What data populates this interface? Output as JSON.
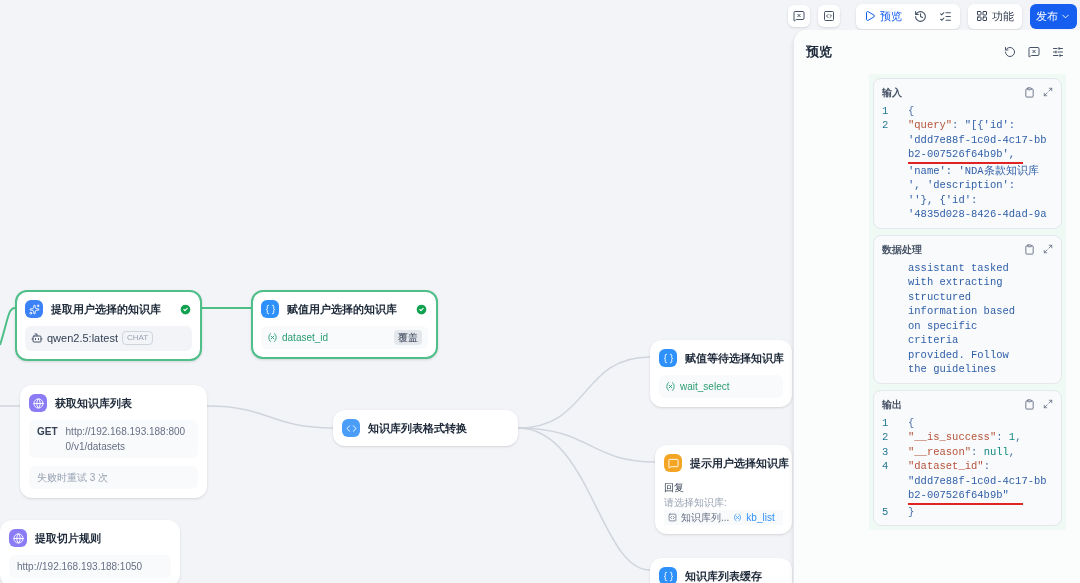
{
  "toolbar": {
    "buttons": [
      {
        "kind": "preview",
        "label": "预览"
      },
      {
        "kind": "features",
        "label": "功能"
      },
      {
        "kind": "publish",
        "label": "发布"
      }
    ]
  },
  "canvas": {
    "nodes": [
      {
        "kind": "llm",
        "title": "提取用户选择的知识库",
        "succeeded": true,
        "model": "qwen2.5:latest",
        "model_mode": "CHAT"
      },
      {
        "kind": "assigner",
        "title": "赋值用户选择的知识库",
        "succeeded": true,
        "variable": "dataset_id",
        "operation": "覆盖"
      },
      {
        "kind": "http",
        "title": "获取知识库列表",
        "succeeded": false,
        "method": "GET",
        "url": "http://192.168.193.188:8000/v1/datasets",
        "retry": "失败时重试 3 次"
      },
      {
        "kind": "code",
        "title": "知识库列表格式转换",
        "succeeded": false
      },
      {
        "kind": "assigner",
        "title": "赋值等待选择知识库",
        "succeeded": false,
        "variable": "wait_select"
      },
      {
        "kind": "answer",
        "title": "提示用户选择知识库",
        "succeeded": false,
        "reply_label": "回复",
        "reply_text": "请选择知识库:",
        "ref_node": "知识库列...",
        "ref_var": "kb_list"
      },
      {
        "kind": "http",
        "title": "提取切片规则",
        "succeeded": false,
        "url": "http://192.168.193.188:1050"
      },
      {
        "kind": "assigner",
        "title": "知识库列表缓存",
        "succeeded": false
      }
    ]
  },
  "preview_panel": {
    "title": "预览",
    "sections": [
      {
        "title": "输入",
        "rows": [
          {
            "number": "1",
            "tokens": [
              {
                "kind": "punct",
                "text": "{"
              }
            ]
          },
          {
            "number": "2",
            "tokens": [
              {
                "kind": "key",
                "text": "\"query\""
              },
              {
                "kind": "punct",
                "text": ": "
              },
              {
                "kind": "string",
                "text": "\"[{'id':"
              }
            ]
          },
          {
            "tokens": [
              {
                "kind": "string",
                "text": "'ddd7e88f-1c0d-4c17-bb"
              }
            ]
          },
          {
            "underlined": true,
            "tokens": [
              {
                "kind": "string",
                "text": "b2-007526f64b9b',"
              }
            ]
          },
          {
            "tokens": [
              {
                "kind": "string",
                "text": "'name': 'NDA条款知识库"
              }
            ]
          },
          {
            "tokens": [
              {
                "kind": "string",
                "text": "', 'description':"
              }
            ]
          },
          {
            "tokens": [
              {
                "kind": "string",
                "text": "''}, {'id':"
              }
            ]
          },
          {
            "tokens": [
              {
                "kind": "string",
                "text": "'4835d028-8426-4dad-9a"
              }
            ]
          }
        ]
      },
      {
        "title": "数据处理",
        "rows": [
          {
            "tokens": [
              {
                "kind": "string",
                "text": "assistant tasked"
              }
            ]
          },
          {
            "tokens": [
              {
                "kind": "string",
                "text": "with extracting"
              }
            ]
          },
          {
            "tokens": [
              {
                "kind": "string",
                "text": "structured"
              }
            ]
          },
          {
            "tokens": [
              {
                "kind": "string",
                "text": "information based"
              }
            ]
          },
          {
            "tokens": [
              {
                "kind": "string",
                "text": "on specific"
              }
            ]
          },
          {
            "tokens": [
              {
                "kind": "string",
                "text": "criteria"
              }
            ]
          },
          {
            "tokens": [
              {
                "kind": "string",
                "text": "provided. Follow"
              }
            ]
          },
          {
            "tokens": [
              {
                "kind": "string",
                "text": "the guidelines"
              }
            ]
          }
        ]
      },
      {
        "title": "输出",
        "rows": [
          {
            "number": "1",
            "tokens": [
              {
                "kind": "punct",
                "text": "{"
              }
            ]
          },
          {
            "number": "2",
            "tokens": [
              {
                "kind": "key",
                "text": "\"__is_success\""
              },
              {
                "kind": "punct",
                "text": ": "
              },
              {
                "kind": "number",
                "text": "1"
              },
              {
                "kind": "punct",
                "text": ","
              }
            ]
          },
          {
            "number": "3",
            "tokens": [
              {
                "kind": "key",
                "text": "\"__reason\""
              },
              {
                "kind": "punct",
                "text": ": "
              },
              {
                "kind": "number",
                "text": "null"
              },
              {
                "kind": "punct",
                "text": ","
              }
            ]
          },
          {
            "number": "4",
            "tokens": [
              {
                "kind": "key",
                "text": "\"dataset_id\""
              },
              {
                "kind": "punct",
                "text": ":"
              }
            ]
          },
          {
            "tokens": [
              {
                "kind": "string",
                "text": "\"ddd7e88f-1c0d-4c17-bb"
              }
            ]
          },
          {
            "underlined": true,
            "tokens": [
              {
                "kind": "string",
                "text": "b2-007526f64b9b\""
              }
            ]
          },
          {
            "number": "5",
            "tokens": [
              {
                "kind": "punct",
                "text": "}"
              }
            ]
          }
        ]
      }
    ]
  }
}
